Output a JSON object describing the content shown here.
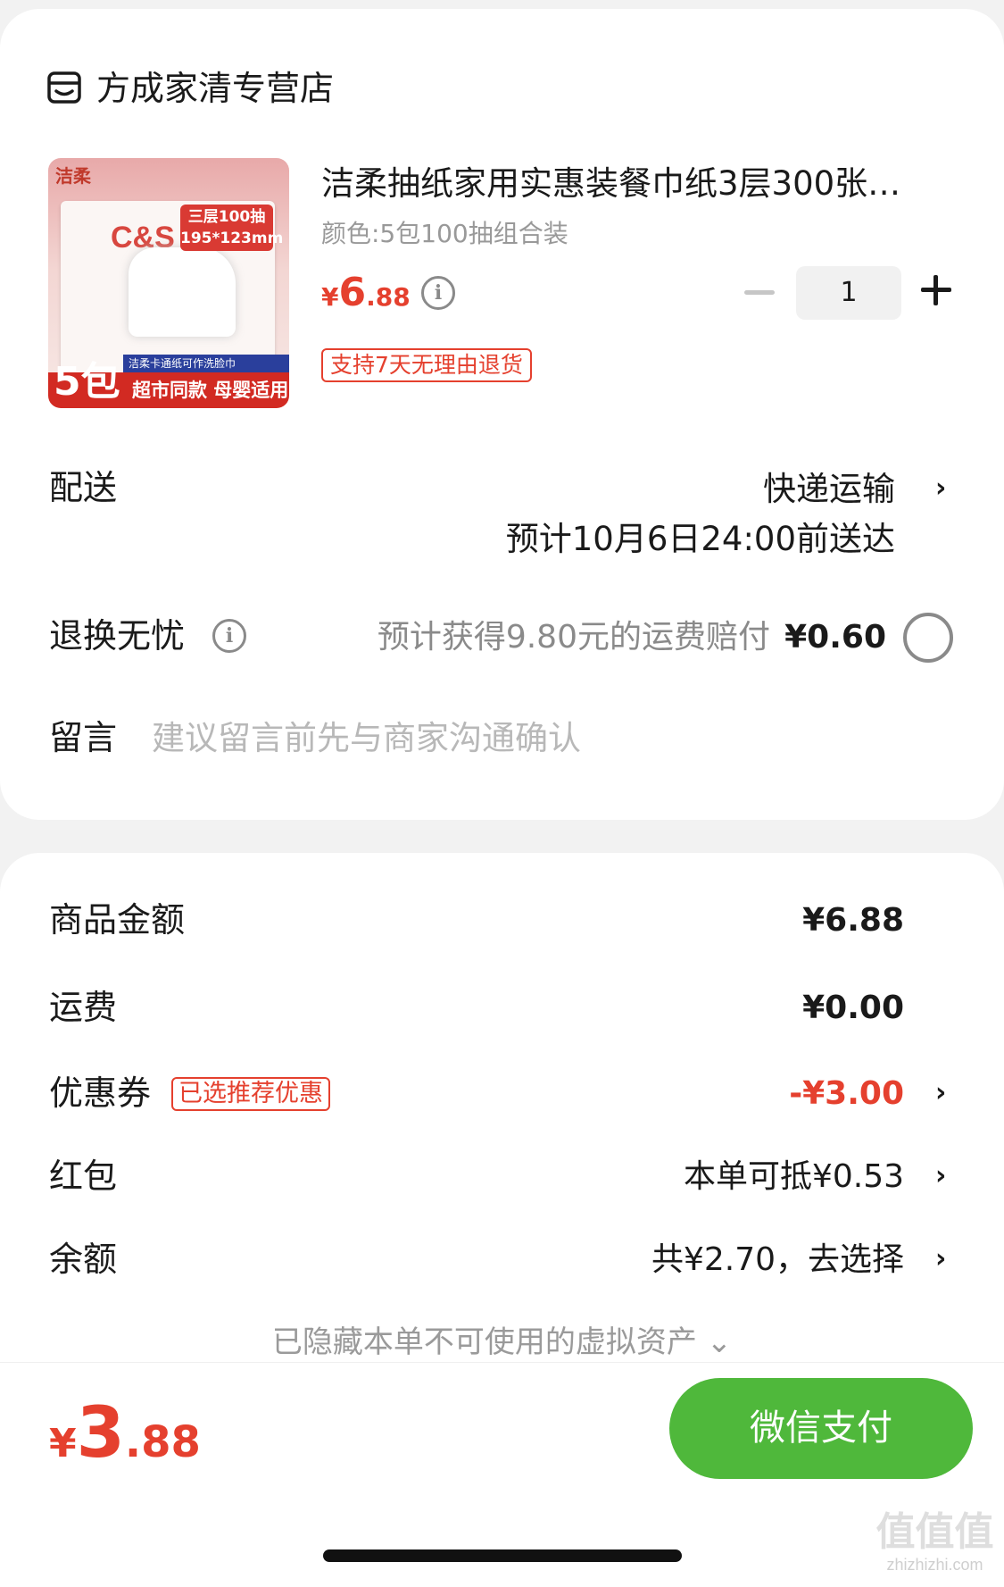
{
  "shop": {
    "name": "方成家清专营店",
    "icon": "shop-icon"
  },
  "product": {
    "title": "洁柔抽纸家用实惠装餐巾纸3层300张…",
    "spec": "颜色:5包100抽组合装",
    "price_currency": "¥",
    "price_int": "6",
    "price_dec": ".88",
    "quantity": "1",
    "return_policy": "支持7天无理由退货",
    "image": {
      "brand": "洁柔",
      "logo": "C&S",
      "tag_line1": "三层100抽",
      "tag_line2": "195*123mm",
      "count": "5包",
      "strip": "洁柔卡通纸可作洗脸巾",
      "slogan": "超市同款 母婴适用"
    }
  },
  "delivery": {
    "label": "配送",
    "method": "快递运输",
    "eta": "预计10月6日24:00前送达"
  },
  "return_insurance": {
    "label": "退换无忧",
    "note": "预计获得9.80元的运费赔付",
    "price": "¥0.60",
    "selected": false
  },
  "message": {
    "label": "留言",
    "placeholder": "建议留言前先与商家沟通确认"
  },
  "summary": {
    "goods_label": "商品金额",
    "goods_value": "¥6.88",
    "shipping_label": "运费",
    "shipping_value": "¥0.00",
    "coupon_label": "优惠券",
    "coupon_badge": "已选推荐优惠",
    "coupon_value": "-¥3.00",
    "redpacket_label": "红包",
    "redpacket_value": "本单可抵¥0.53",
    "balance_label": "余额",
    "balance_value": "共¥2.70，去选择",
    "hidden_assets": "已隐藏本单不可使用的虚拟资产 ⌄"
  },
  "checkout": {
    "total_currency": "¥",
    "total_int": "3",
    "total_dec": ".88",
    "pay_label": "微信支付"
  },
  "watermark": {
    "main": "值值值",
    "sub": "zhizhizhi.com"
  },
  "colors": {
    "accent_red": "#e5402e",
    "pay_green": "#4fb83b"
  }
}
